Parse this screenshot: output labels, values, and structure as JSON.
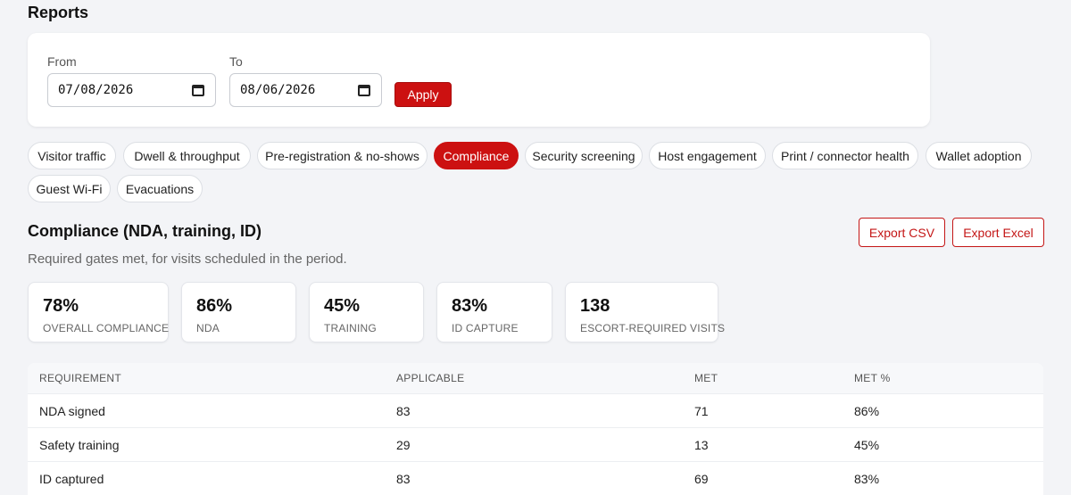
{
  "page": {
    "title": "Reports"
  },
  "filters": {
    "from_label": "From",
    "from_value": "07/08/2026",
    "to_label": "To",
    "to_value": "08/06/2026",
    "apply_label": "Apply"
  },
  "tabs": [
    {
      "label": "Visitor traffic",
      "active": false
    },
    {
      "label": "Dwell & throughput",
      "active": false
    },
    {
      "label": "Pre-registration & no-shows",
      "active": false
    },
    {
      "label": "Compliance",
      "active": true
    },
    {
      "label": "Security screening",
      "active": false
    },
    {
      "label": "Host engagement",
      "active": false
    },
    {
      "label": "Print / connector health",
      "active": false
    },
    {
      "label": "Wallet adoption",
      "active": false
    },
    {
      "label": "Guest Wi-Fi",
      "active": false
    },
    {
      "label": "Evacuations",
      "active": false
    }
  ],
  "section": {
    "title": "Compliance (NDA, training, ID)",
    "subtitle": "Required gates met, for visits scheduled in the period.",
    "export_csv_label": "Export CSV",
    "export_excel_label": "Export Excel"
  },
  "kpis": [
    {
      "value": "78%",
      "label": "OVERALL COMPLIANCE"
    },
    {
      "value": "86%",
      "label": "NDA"
    },
    {
      "value": "45%",
      "label": "TRAINING"
    },
    {
      "value": "83%",
      "label": "ID CAPTURE"
    },
    {
      "value": "138",
      "label": "ESCORT-REQUIRED VISITS"
    }
  ],
  "table": {
    "columns": [
      "REQUIREMENT",
      "APPLICABLE",
      "MET",
      "MET %"
    ],
    "rows": [
      [
        "NDA signed",
        "83",
        "71",
        "86%"
      ],
      [
        "Safety training",
        "29",
        "13",
        "45%"
      ],
      [
        "ID captured",
        "83",
        "69",
        "83%"
      ]
    ]
  },
  "colors": {
    "accent": "#cc1111",
    "background": "#f3f4f7"
  }
}
